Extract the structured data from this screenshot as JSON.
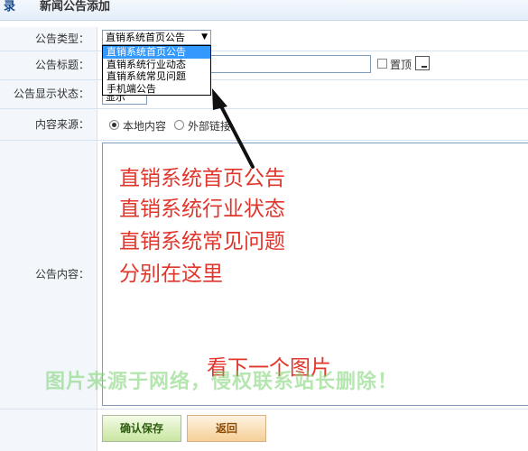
{
  "header": {
    "crumb": "录",
    "title": "新闻公告添加"
  },
  "form": {
    "type_label": "公告类型：",
    "type_selected": "直销系统首页公告",
    "type_options": [
      "直销系统首页公告",
      "直销系统行业动态",
      "直销系统常见问题",
      "手机端公告"
    ],
    "title_label": "公告标题：",
    "pin_label": "置顶",
    "status_label": "公告显示状态：",
    "status_value": "显示",
    "source_label": "内容来源：",
    "source_options": [
      "本地内容",
      "外部链接"
    ],
    "content_label": "公告内容："
  },
  "annotation": {
    "lines": [
      "直销系统首页公告",
      "直销系统行业状态",
      "直销系统常见问题",
      "分别在这里"
    ],
    "next": "看下一个图片",
    "color": "#e0362c"
  },
  "watermark": "图片来源于网络，侵权联系站长删除！",
  "buttons": {
    "save": "确认保存",
    "back": "返回"
  },
  "colors": {
    "option_highlight": "#3399ff",
    "label_bg": "#f3f7fc"
  }
}
